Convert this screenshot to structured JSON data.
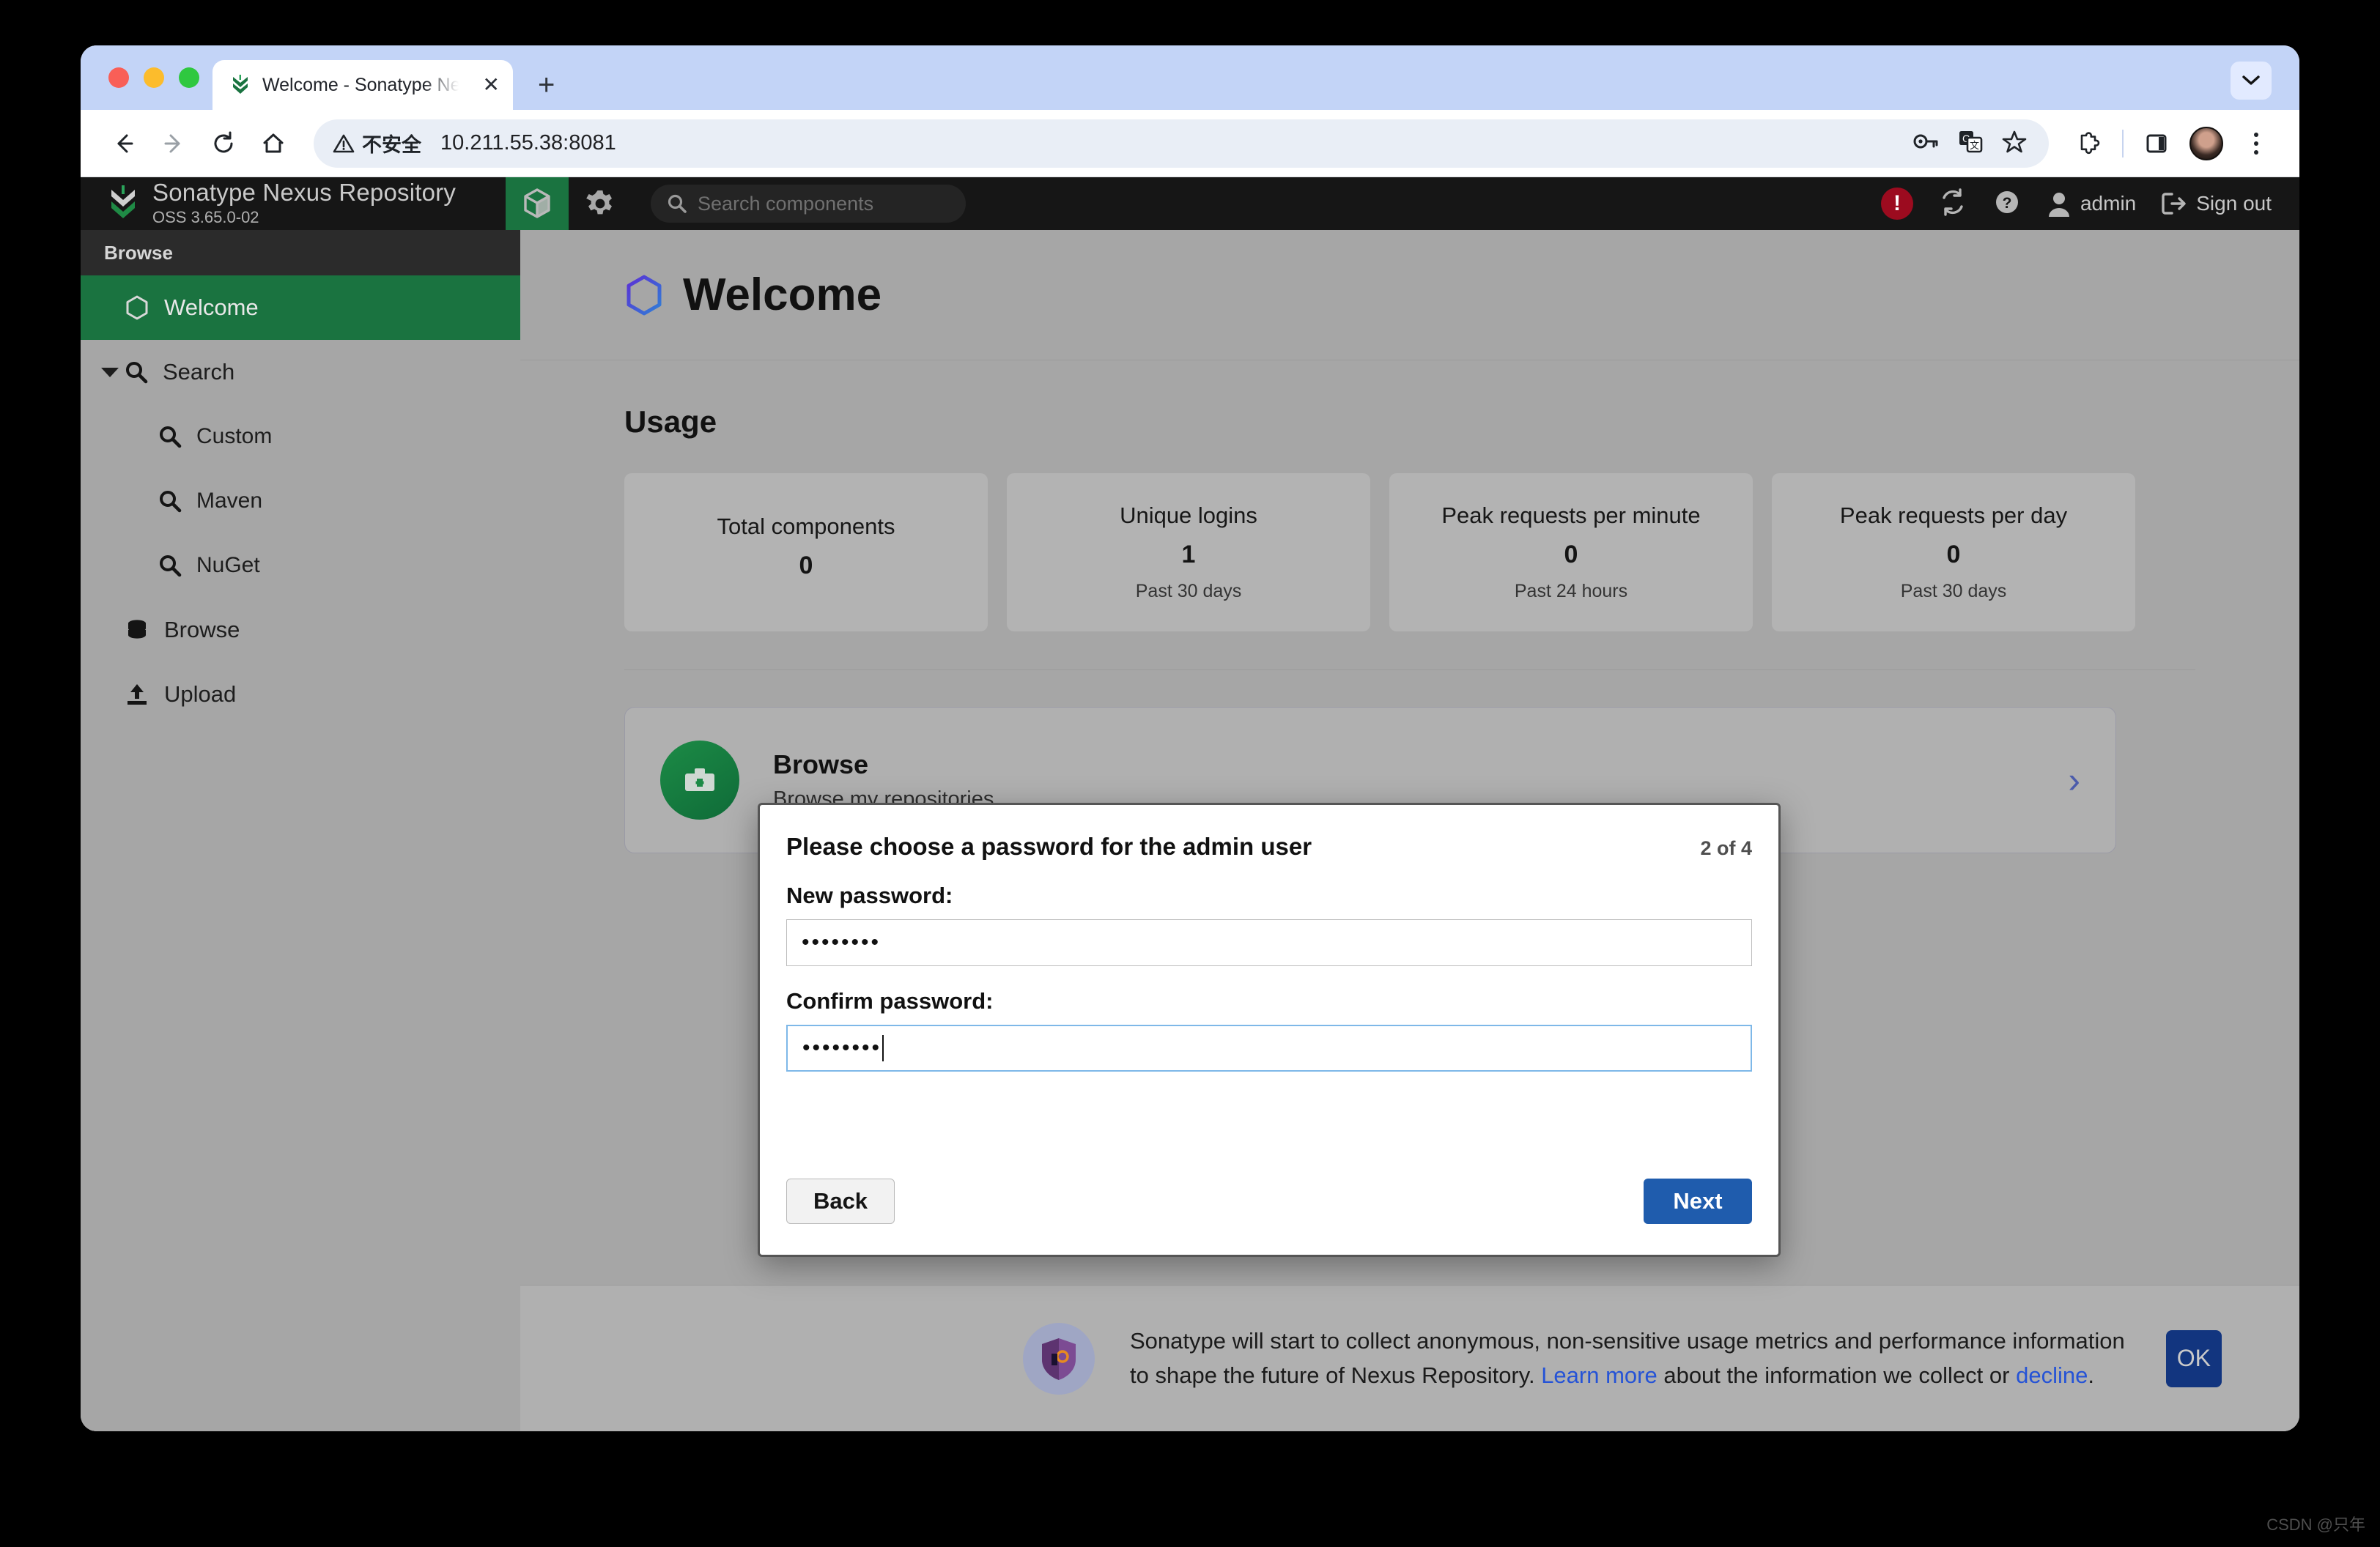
{
  "browser": {
    "tab": {
      "title": "Welcome - Sonatype Nexus R",
      "close_label": "✕",
      "favicon": "nexus-favicon"
    },
    "new_tab_label": "+",
    "toolbar": {
      "back": "back-arrow",
      "forward": "forward-arrow",
      "reload": "reload",
      "home": "home",
      "not_secure_label": "不安全",
      "url": "10.211.55.38:8081",
      "icons": [
        "key-icon",
        "translate-icon",
        "bookmark-star-icon",
        "extensions-icon",
        "side-panel-icon",
        "profile-avatar"
      ]
    }
  },
  "nexus": {
    "brand": {
      "title": "Sonatype Nexus Repository",
      "version": "OSS 3.65.0-02"
    },
    "search": {
      "placeholder": "Search components",
      "value": ""
    },
    "header_right": {
      "user": "admin",
      "sign_out": "Sign out",
      "alert": "!"
    },
    "sidebar": {
      "header": "Browse",
      "items": [
        {
          "label": "Welcome",
          "icon": "hexagon-icon",
          "active": true,
          "sub": false
        },
        {
          "label": "Search",
          "icon": "search-icon",
          "active": false,
          "sub": false,
          "expandable": true
        },
        {
          "label": "Custom",
          "icon": "search-icon",
          "active": false,
          "sub": true
        },
        {
          "label": "Maven",
          "icon": "search-icon",
          "active": false,
          "sub": true
        },
        {
          "label": "NuGet",
          "icon": "search-icon",
          "active": false,
          "sub": true
        },
        {
          "label": "Browse",
          "icon": "database-icon",
          "active": false,
          "sub": false
        },
        {
          "label": "Upload",
          "icon": "upload-icon",
          "active": false,
          "sub": false
        }
      ]
    },
    "page": {
      "title": "Welcome",
      "usage_heading": "Usage",
      "cards": [
        {
          "label": "Total components",
          "value": "0",
          "sub": ""
        },
        {
          "label": "Unique logins",
          "value": "1",
          "sub": "Past 30 days"
        },
        {
          "label": "Peak requests per minute",
          "value": "0",
          "sub": "Past 24 hours"
        },
        {
          "label": "Peak requests per day",
          "value": "0",
          "sub": "Past 30 days"
        }
      ],
      "tiles": [
        {
          "title": "Browse",
          "desc": "Browse my repositories",
          "icon": "repository-kit-icon",
          "chevron": "›"
        }
      ]
    },
    "banner": {
      "text_1": "Sonatype will start to collect anonymous, non-sensitive usage metrics and performance information to shape the future of Nexus Repository. ",
      "link_learn_more": "Learn more",
      "text_2": " about the information we collect or ",
      "link_decline": "decline",
      "text_3": ".",
      "ok_label": "OK",
      "icon": "shield-lock-icon"
    }
  },
  "modal": {
    "title": "Please choose a password for the admin user",
    "step": "2 of 4",
    "new_password_label": "New password:",
    "new_password_value": "••••••••",
    "confirm_password_label": "Confirm password:",
    "confirm_password_value": "••••••••",
    "back_label": "Back",
    "next_label": "Next"
  },
  "watermark": "CSDN @只年",
  "colors": {
    "nexus_green": "#1a7340",
    "header_dark": "#161616",
    "next_blue": "#1f5cad",
    "ok_blue": "#12357f",
    "link_blue": "#2553d6",
    "alert_red": "#9c0b1f"
  }
}
